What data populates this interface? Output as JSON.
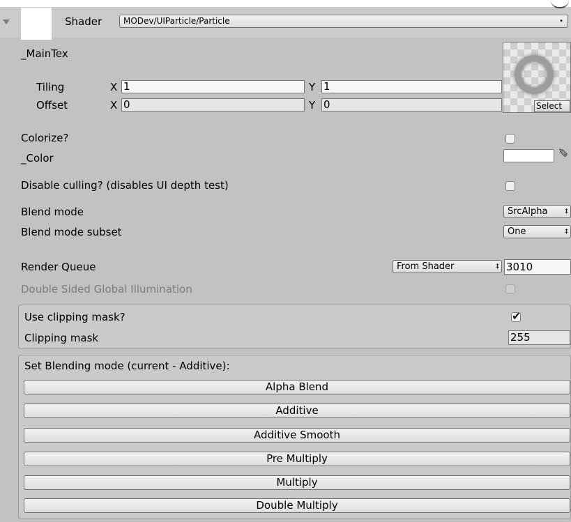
{
  "header": {
    "shader_label": "Shader",
    "shader_value": "MODev/UIParticle/Particle",
    "dropdown_arrow": "•"
  },
  "main_tex": {
    "label": "_MainTex",
    "tiling_label": "Tiling",
    "offset_label": "Offset",
    "x_label": "X",
    "y_label": "Y",
    "tiling_x": "1",
    "tiling_y": "1",
    "offset_x": "0",
    "offset_y": "0",
    "select_label": "Select"
  },
  "properties": {
    "colorize_label": "Colorize?",
    "colorize_checked": false,
    "color_label": "_Color",
    "color_value": "#ffffff",
    "disable_culling_label": "Disable culling? (disables UI depth test)",
    "disable_culling_checked": false,
    "blend_mode_label": "Blend mode",
    "blend_mode_value": "SrcAlpha",
    "blend_subset_label": "Blend mode subset",
    "blend_subset_value": "One",
    "popup_arrow": "‡",
    "render_queue_label": "Render Queue",
    "render_queue_source": "From Shader",
    "render_queue_value": "3010",
    "dsgi_label": "Double Sided Global Illumination",
    "dsgi_checked": false
  },
  "clipping": {
    "use_label": "Use clipping mask?",
    "use_checked": true,
    "check_glyph": "✔",
    "mask_label": "Clipping mask",
    "mask_value": "255"
  },
  "blending": {
    "title": "Set Blending mode (current - Additive):",
    "buttons": [
      "Alpha Blend",
      "Additive",
      "Additive Smooth",
      "Pre Multiply",
      "Multiply",
      "Double Multiply"
    ]
  },
  "icons": {
    "foldout": "triangle-down-icon",
    "eyedropper": "eyedropper-icon",
    "checkmark": "checkmark-icon"
  }
}
